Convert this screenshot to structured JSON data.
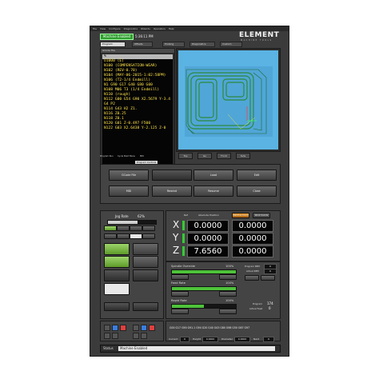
{
  "menu": [
    "File",
    "View",
    "Configure",
    "Diagnostics",
    "Wizards",
    "Operators",
    "Help"
  ],
  "status_badge": "Machine Enabled",
  "clock": "5:36:11 PM",
  "logo": {
    "name": "ELEMENT",
    "sub": "MACHINE TOOLS"
  },
  "tabs": [
    "Program",
    "Offsets",
    "Probing",
    "Diagnostics",
    "Custom"
  ],
  "gcode": {
    "title": "GCode File",
    "lines": [
      "%",
      "O1000 (E)",
      "N100 (COMPENSATION-WEAR)",
      "N102 (REV-0.70)",
      "N104 (MAY-06-2015-1:02:58PM)",
      "",
      "",
      "N106 (T2-1/4 Endmill)",
      "",
      "",
      "N1 G90 G17 G40 G80 G00",
      "N108 M06 T3 (1/4 Endmill)",
      "N110 (rough)",
      "N112 G00 G54 G90 X2.5679 Y-3.4",
      "G4 P2",
      "N114 G43 H2 Z1.",
      "N116 Z0.25",
      "N118 Z0.1",
      "N120 G01 Z-0.497 F500",
      "N122 G03 X2.6438 Y-2.125 Z-0"
    ]
  },
  "view_buttons": [
    "Top",
    "Iso",
    "Front",
    "Side"
  ],
  "lower_tabs": [
    "Program Run",
    "Cycle Start Menu",
    "MDI",
    "Program Controls"
  ],
  "controls": {
    "row1": [
      "GCode File",
      "",
      "Load",
      "Edit"
    ],
    "row2": [
      "MDI",
      "Rewind",
      "Resume",
      "Close"
    ]
  },
  "jog": {
    "title": "Jog Rate",
    "value": "62%"
  },
  "dro": {
    "ref_label": "Ref",
    "abs_label": "Absolute Position",
    "btn_machine": "Machine Coord",
    "btn_work": "Work Coords",
    "axes": [
      {
        "name": "X",
        "abs": "0.0000",
        "mach": "0.0000"
      },
      {
        "name": "Y",
        "abs": "0.0000",
        "mach": "0.0000"
      },
      {
        "name": "Z",
        "abs": "7.6560",
        "mach": "0.0000"
      }
    ]
  },
  "spindle": {
    "label": "Spindle Override",
    "pct": "100%",
    "progress": 1.0,
    "prog_rpm_label": "Program RPM",
    "actual_rpm_label": "Actual RPM",
    "prog_rpm": "0",
    "actual_rpm": "0"
  },
  "feed": {
    "label": "Feed Rate",
    "pct": "100%",
    "progress": 1.0
  },
  "rapid": {
    "label": "Rapid Rate",
    "pct": "100%",
    "progress": 0.5,
    "prog_label": "Program",
    "prog_val": "174",
    "actual_label": "Actual Feed",
    "actual_val": "0"
  },
  "gcodes_line": "G00 G17 G90 G91.1 G94 G20 G40 G43 G80 G98 G50 G67 G97",
  "bottom": {
    "current_label": "Current",
    "current": "0",
    "height_label": "Height",
    "height": "0.0000",
    "diameter_label": "Diameter",
    "diameter": "0.0000",
    "next_label": "Next",
    "next": "0"
  },
  "status": {
    "label": "Status",
    "value": "Machine Enabled"
  }
}
